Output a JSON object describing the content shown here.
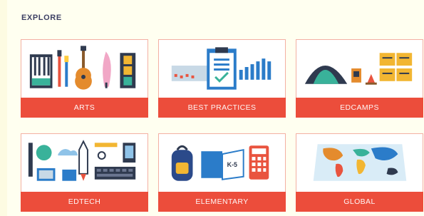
{
  "heading": "EXPLORE",
  "cards": [
    {
      "label": "ARTS",
      "icon": "arts-icon"
    },
    {
      "label": "BEST PRACTICES",
      "icon": "clipboard-chart-icon"
    },
    {
      "label": "EDCAMPS",
      "icon": "camp-tent-icon"
    },
    {
      "label": "EDTECH",
      "icon": "edtech-gadgets-icon"
    },
    {
      "label": "ELEMENTARY",
      "icon": "backpack-books-icon"
    },
    {
      "label": "GLOBAL",
      "icon": "world-map-icon"
    }
  ],
  "colors": {
    "accent": "#ec4d3b",
    "border": "#f3b0a3",
    "heading": "#3c3f63",
    "background": "#fdfbe2"
  }
}
